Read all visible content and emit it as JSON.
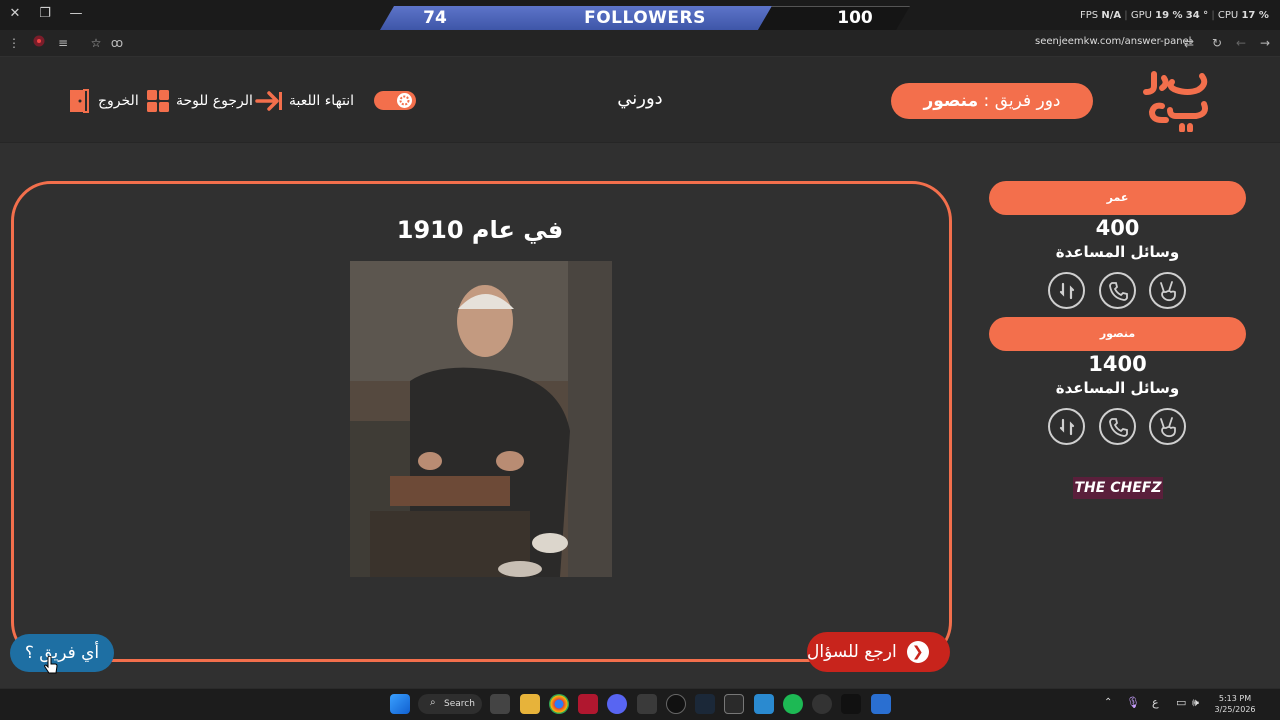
{
  "window_controls": {
    "close": "✕",
    "restore": "❐",
    "minimize": "—"
  },
  "stream_overlay": {
    "left_count": "74",
    "label": "FOLLOWERS",
    "right_count": "100"
  },
  "hw_stats": {
    "fps_label": "FPS",
    "fps_value": "N/A",
    "gpu_label": "GPU",
    "gpu_value": "19 %",
    "gpu_temp": "34 °",
    "cpu_label": "CPU",
    "cpu_value": "17 %"
  },
  "browser": {
    "url": "seenjeemkw.com/answer-panel"
  },
  "header": {
    "turn_prefix": "دور فريق : ",
    "turn_team": "منصور",
    "round_title": "دورني",
    "end_game_label": "انتهاء اللعبة",
    "back_to_board_label": "الرجوع للوحة",
    "exit_label": "الخروج"
  },
  "question": {
    "title": "في عام 1910"
  },
  "buttons": {
    "back_to_question": "ارجع للسؤال",
    "which_team": "أي فريق ؟"
  },
  "teams": [
    {
      "name": "عمر",
      "score": "400",
      "aids_label": "وسائل المساعدة"
    },
    {
      "name": "منصور",
      "score": "1400",
      "aids_label": "وسائل المساعدة"
    }
  ],
  "sponsor": {
    "name": "THE CHEFZ"
  },
  "taskbar": {
    "search_label": "Search",
    "time": "5:13 PM",
    "date": "3/25/2026",
    "lang": "ع"
  },
  "colors": {
    "accent": "#f36f4c",
    "back_button": "#c8241c",
    "which_team_button": "#1e6fa3",
    "background": "#303030"
  }
}
